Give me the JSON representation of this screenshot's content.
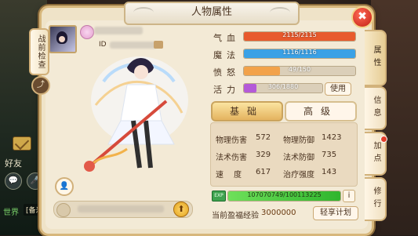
{
  "background": {
    "friend_label": "好友",
    "world_label": "世界",
    "world_tag": "[备米]"
  },
  "panel": {
    "title": "人物属性",
    "war_check_tab": "战前检查",
    "id_label": "ID"
  },
  "stats": {
    "hp": {
      "label": "气血",
      "value": 2115,
      "max": 2115,
      "text": "2115/2115",
      "color": "#e85a2d"
    },
    "mp": {
      "label": "魔法",
      "value": 1116,
      "max": 1116,
      "text": "1116/1116",
      "color": "#3aa1e6"
    },
    "rage": {
      "label": "愤怒",
      "value": 49,
      "max": 150,
      "text": "49/150",
      "color": "#f2a24a"
    },
    "vitality": {
      "label": "活力",
      "value": 306,
      "max": 1880,
      "text": "306/1880",
      "color": "#b45ad8"
    },
    "use_button": "使用"
  },
  "tabs": {
    "basic": "基础",
    "advanced": "高级"
  },
  "attributes": [
    {
      "label": "物理伤害",
      "value": "572"
    },
    {
      "label": "物理防御",
      "value": "1423"
    },
    {
      "label": "法术伤害",
      "value": "329"
    },
    {
      "label": "法术防御",
      "value": "735"
    },
    {
      "label": "速度",
      "value": "617"
    },
    {
      "label": "治疗强度",
      "value": "143"
    }
  ],
  "experience": {
    "text": "107070749/100113225",
    "fraction": 1.0,
    "surplus_label": "当前盈福经验",
    "surplus_value": "3000000",
    "plan_button": "轻享计划"
  },
  "side_tabs": [
    "属性",
    "信息",
    "加点",
    "修行"
  ]
}
